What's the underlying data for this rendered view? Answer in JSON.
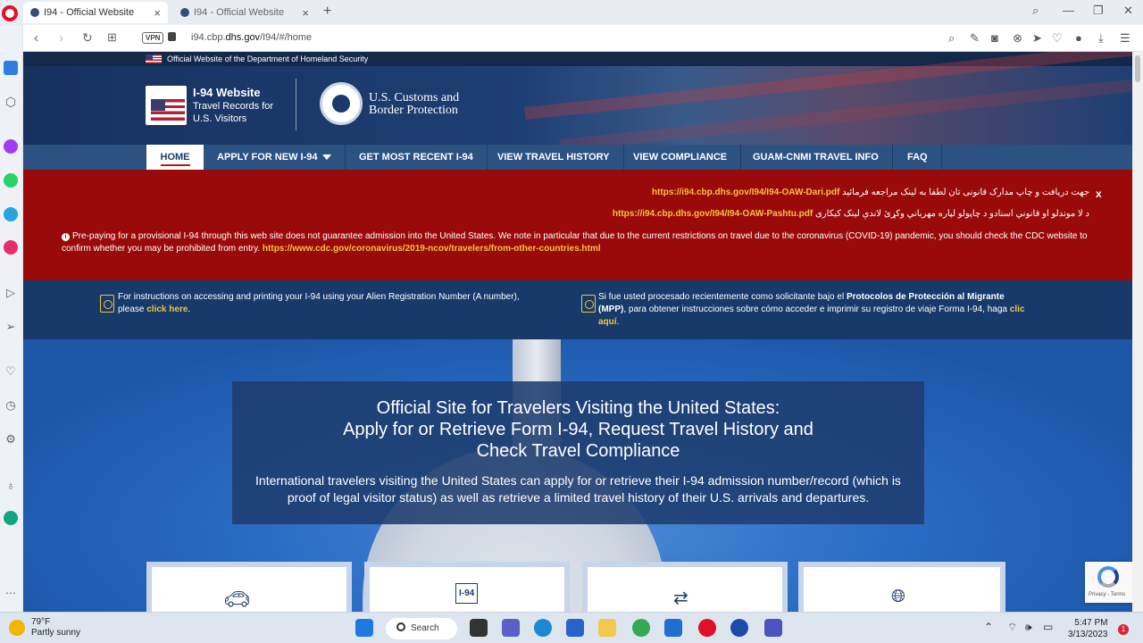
{
  "browser": {
    "tabs": [
      {
        "label": "I94 - Official Website",
        "active": true
      },
      {
        "label": "I94 - Official Website",
        "active": false
      }
    ],
    "url_prefix": "i94.cbp.",
    "url_domain": "dhs.gov",
    "url_path": "/I94/#/home",
    "vpn_label": "VPN"
  },
  "site": {
    "gov_banner": "Official Website of the Department of Homeland Security",
    "logo_title": "I-94 Website",
    "logo_sub": "Travel Records for U.S. Visitors",
    "agency_line1": "U.S. Customs and",
    "agency_line2": "Border Protection",
    "nav": [
      {
        "label": "HOME",
        "active": true
      },
      {
        "label": "APPLY FOR NEW I-94",
        "dropdown": true
      },
      {
        "label": "GET MOST RECENT I-94"
      },
      {
        "label": "VIEW TRAVEL HISTORY"
      },
      {
        "label": "VIEW COMPLIANCE"
      },
      {
        "label": "GUAM-CNMI TRAVEL INFO"
      },
      {
        "label": "FAQ"
      }
    ]
  },
  "alert": {
    "dari_text": "جهت دریافت و چاپ مدارک قانونی تان لطفا به لینک مراجعه فرمائید",
    "dari_link": "https://i94.cbp.dhs.gov/I94/I94-OAW-Dari.pdf",
    "pashtu_text": "د لا موندلو او قانوني اسنادو د چاپولو لپاره مهرباني وکړئ لاندې لینک کیکاری",
    "pashtu_link": "https://i94.cbp.dhs.gov/I94/I94-OAW-Pashtu.pdf",
    "close_label": "x",
    "warning": "Pre-paying for a provisional I-94 through this web site does not guarantee admission into the United States. We note in particular that due to the current restrictions on travel due to the coronavirus (COVID-19) pandemic, you should check the CDC website to confirm whether you may be prohibited from entry.",
    "cdc_link": "https://www.cdc.gov/coronavirus/2019-ncov/travelers/from-other-countries.html"
  },
  "notices": {
    "left_text": "For instructions on accessing and printing your I-94 using your Alien Registration Number (A number), please",
    "left_link": "click here",
    "left_end": ".",
    "right_text1": "Si fue usted procesado recientemente como solicitante bajo el",
    "right_bold": "Protocolos de Protección al Migrante (MPP)",
    "right_text2": ", para obtener instrucciones sobre cómo acceder e imprimir su registro de viaje Forma I-94, haga",
    "right_link": "clic aquí",
    "right_end": "."
  },
  "hero": {
    "title_line1": "Official Site for Travelers Visiting the United States:",
    "title_line2": "Apply for or Retrieve Form I-94, Request Travel History and",
    "title_line3": "Check Travel Compliance",
    "description": "International travelers visiting the United States can apply for or retrieve their I-94 admission number/record (which is proof of legal visitor status) as well as retrieve a limited travel history of their U.S. arrivals and departures."
  },
  "cards": [
    {
      "icon": "car-icon"
    },
    {
      "icon": "i94-document-icon",
      "icon_text": "I-94"
    },
    {
      "icon": "suitcase-icon"
    },
    {
      "icon": "globe-icon"
    }
  ],
  "recaptcha": {
    "text": "Privacy - Terms"
  },
  "taskbar": {
    "temperature": "79°F",
    "weather": "Partly sunny",
    "search_label": "Search",
    "time": "5:47 PM",
    "date": "3/13/2023",
    "notification_count": "1"
  }
}
